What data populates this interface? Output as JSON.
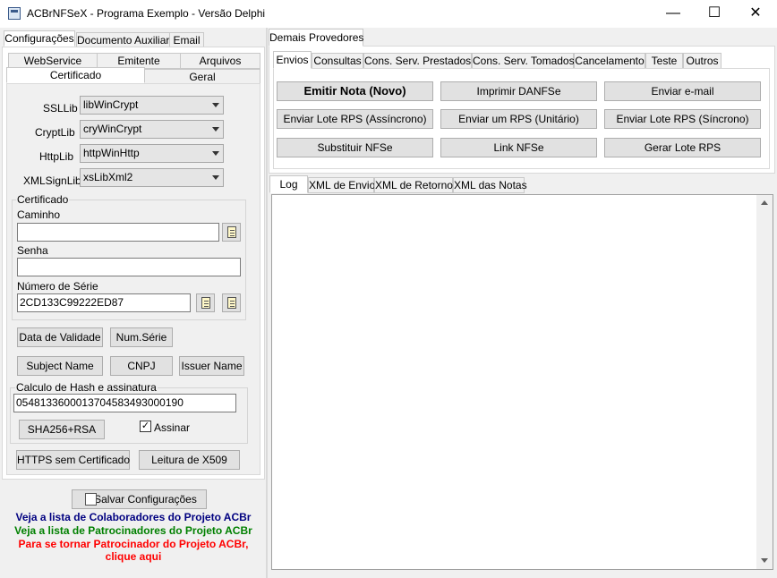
{
  "window": {
    "title": "ACBrNFSeX - Programa Exemplo - Versão Delphi",
    "minimize": "—",
    "maximize": "☐",
    "close": "✕"
  },
  "left": {
    "tabs": [
      "Configurações",
      "Documento Auxiliar",
      "Email"
    ],
    "subtabs_row1": [
      "WebService",
      "Emitente",
      "Arquivos"
    ],
    "subtabs_row2": [
      "Certificado",
      "Geral"
    ],
    "ssllib": {
      "label": "SSLLib",
      "value": "libWinCrypt"
    },
    "cryptlib": {
      "label": "CryptLib",
      "value": "cryWinCrypt"
    },
    "httplib": {
      "label": "HttpLib",
      "value": "httpWinHttp"
    },
    "xmlsignlib": {
      "label": "XMLSignLib",
      "value": "xsLibXml2"
    },
    "cert_group": "Certificado",
    "caminho_label": "Caminho",
    "caminho_value": "",
    "senha_label": "Senha",
    "senha_value": "",
    "serie_label": "Número de Série",
    "serie_value": "2CD133C99222ED87",
    "btn_data_validade": "Data de Validade",
    "btn_num_serie": "Num.Série",
    "btn_subject": "Subject Name",
    "btn_cnpj": "CNPJ",
    "btn_issuer": "Issuer Name",
    "hash_group": "Calculo de Hash e assinatura",
    "hash_value": "05481336000137045834930001​90",
    "btn_sha": "SHA256+RSA",
    "assinar_label": "Assinar",
    "assinar_checked": "✓",
    "btn_https": "HTTPS sem Certificado",
    "btn_x509": "Leitura de X509",
    "btn_salvar": "Salvar Configurações",
    "link_colab": "Veja a lista de Colaboradores do Projeto ACBr",
    "link_patro": "Veja a lista de Patrocinadores do Projeto ACBr",
    "link_tornar_1": "Para se tornar Patrocinador do Projeto ACBr,",
    "link_tornar_2": "clique aqui",
    "colors": {
      "colab": "#000080",
      "patro": "#008000",
      "tornar": "#ff0000"
    }
  },
  "right": {
    "top_tab": "Demais Provedores",
    "tabs": [
      "Envios",
      "Consultas",
      "Cons. Serv. Prestados",
      "Cons. Serv. Tomados",
      "Cancelamento",
      "Teste",
      "Outros"
    ],
    "buttons": {
      "emitir": "Emitir Nota (Novo)",
      "imprimir": "Imprimir DANFSe",
      "email": "Enviar e-mail",
      "lote_async": "Enviar Lote RPS (Assíncrono)",
      "um_rps": "Enviar um RPS (Unitário)",
      "lote_sync": "Enviar Lote RPS (Síncrono)",
      "substituir": "Substituir NFSe",
      "link": "Link NFSe",
      "gerar": "Gerar Lote RPS"
    },
    "log_tabs": [
      "Log",
      "XML de Envio",
      "XML de Retorno",
      "XML das Notas"
    ]
  }
}
